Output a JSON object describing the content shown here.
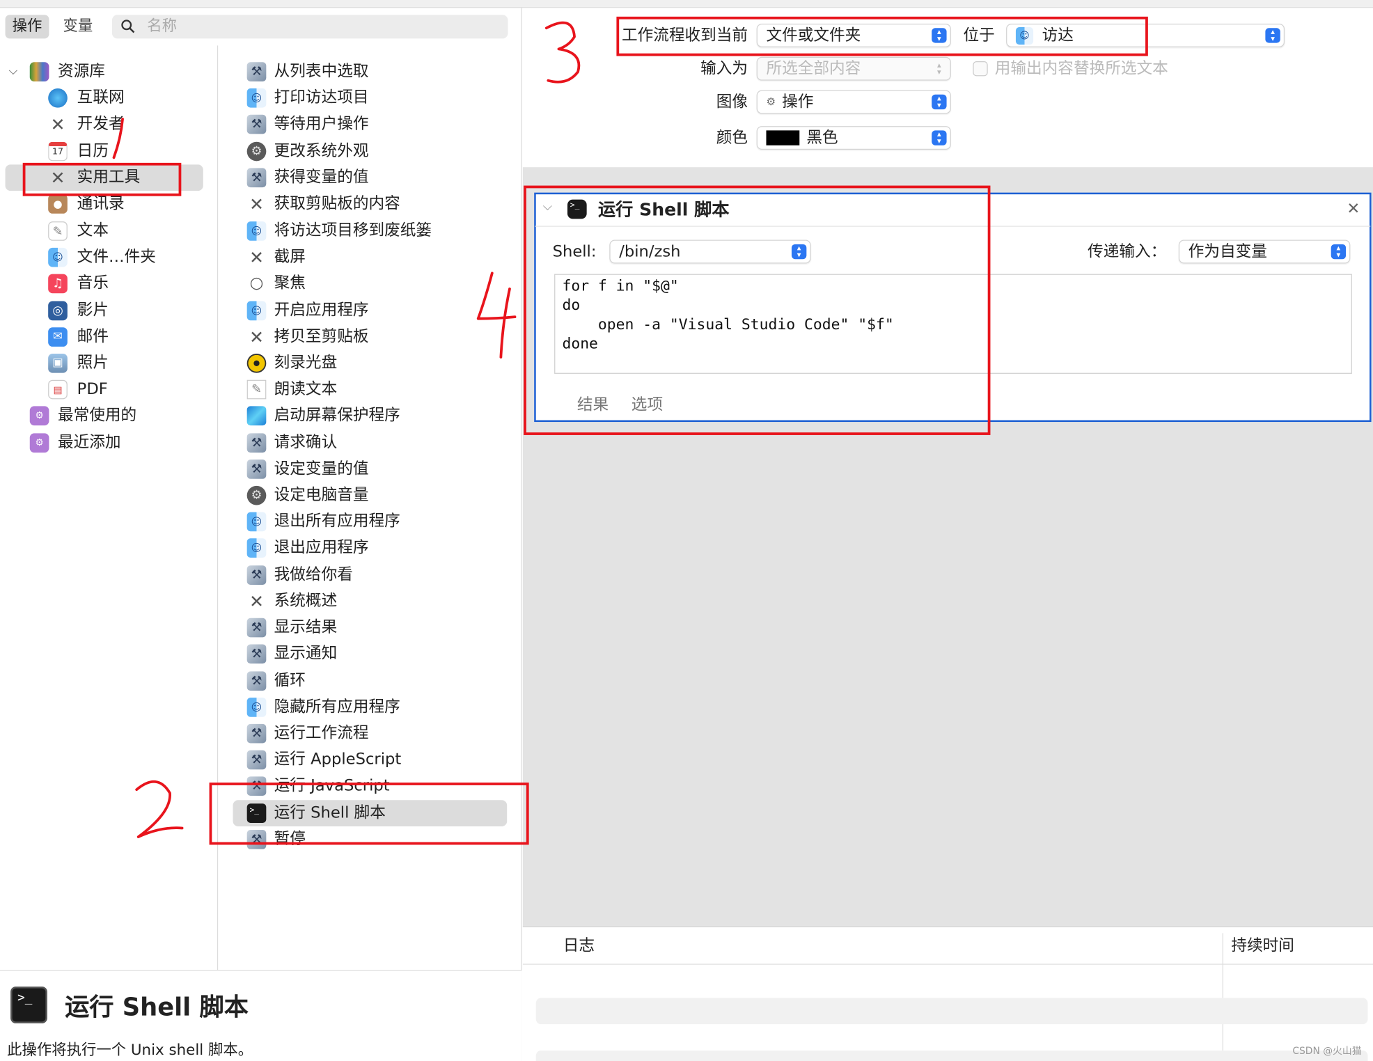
{
  "toolbar": {
    "tab_actions": "操作",
    "tab_variables": "变量",
    "search_placeholder": "名称"
  },
  "library": {
    "root": "资源库",
    "items": [
      "互联网",
      "开发者",
      "日历",
      "实用工具",
      "通讯录",
      "文本",
      "文件…件夹",
      "音乐",
      "影片",
      "邮件",
      "照片",
      "PDF"
    ],
    "calendar_day": "17",
    "groups": [
      "最常使用的",
      "最近添加"
    ],
    "selected": "实用工具"
  },
  "actions": {
    "items": [
      "从列表中选取",
      "打印访达项目",
      "等待用户操作",
      "更改系统外观",
      "获得变量的值",
      "获取剪贴板的内容",
      "将访达项目移到废纸篓",
      "截屏",
      "聚焦",
      "开启应用程序",
      "拷贝至剪贴板",
      "刻录光盘",
      "朗读文本",
      "启动屏幕保护程序",
      "请求确认",
      "设定变量的值",
      "设定电脑音量",
      "退出所有应用程序",
      "退出应用程序",
      "我做给你看",
      "系统概述",
      "显示结果",
      "显示通知",
      "循环",
      "隐藏所有应用程序",
      "运行工作流程",
      "运行 AppleScript",
      "运行 JavaScript",
      "运行 Shell 脚本",
      "暂停"
    ],
    "selected": "运行 Shell 脚本"
  },
  "detail": {
    "title": "运行 Shell 脚本",
    "description": "此操作将执行一个 Unix shell 脚本。"
  },
  "workflow": {
    "receives_label": "工作流程收到当前",
    "receives_value": "文件或文件夹",
    "in_label": "位于",
    "in_value": "访达",
    "input_label": "输入为",
    "input_value": "所选全部内容",
    "replace_label": "用输出内容替换所选文本",
    "image_label": "图像",
    "image_value": "操作",
    "color_label": "颜色",
    "color_value": "黑色",
    "color_swatch": "#000000"
  },
  "shell_action": {
    "title": "运行 Shell 脚本",
    "shell_label": "Shell:",
    "shell_value": "/bin/zsh",
    "pass_input_label": "传递输入：",
    "pass_input_value": "作为自变量",
    "script": "for f in \"$@\"\ndo\n    open -a \"Visual Studio Code\" \"$f\"\ndone",
    "tab_results": "结果",
    "tab_options": "选项"
  },
  "log": {
    "col_log": "日志",
    "col_duration": "持续时间"
  },
  "watermark": "CSDN @火山猫",
  "annotation_numbers": [
    "1",
    "2",
    "3",
    "4"
  ],
  "colors": {
    "annotation_red": "#e8141c",
    "focus_blue": "#1c5fd3",
    "accent": "#2b76f2"
  }
}
